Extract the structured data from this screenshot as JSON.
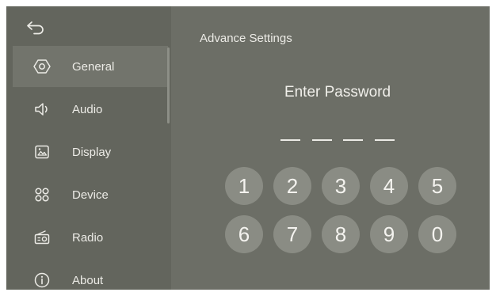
{
  "back": {
    "icon": "back-arrow-icon"
  },
  "sidebar": {
    "items": [
      {
        "label": "General",
        "icon": "settings-hexagon-icon",
        "active": true
      },
      {
        "label": "Audio",
        "icon": "speaker-icon"
      },
      {
        "label": "Display",
        "icon": "picture-icon"
      },
      {
        "label": "Device",
        "icon": "device-grid-icon"
      },
      {
        "label": "Radio",
        "icon": "radio-icon"
      },
      {
        "label": "About",
        "icon": "info-icon"
      }
    ]
  },
  "main": {
    "title": "Advance Settings",
    "password_prompt": "Enter Password",
    "password_slots": 4,
    "keypad": [
      "1",
      "2",
      "3",
      "4",
      "5",
      "6",
      "7",
      "8",
      "9",
      "0"
    ]
  },
  "colors": {
    "background": "#6c6e66",
    "sidebar": "#63655d",
    "active_item": "#72746c",
    "key": "#8a8c84",
    "text": "#ecebe6"
  }
}
